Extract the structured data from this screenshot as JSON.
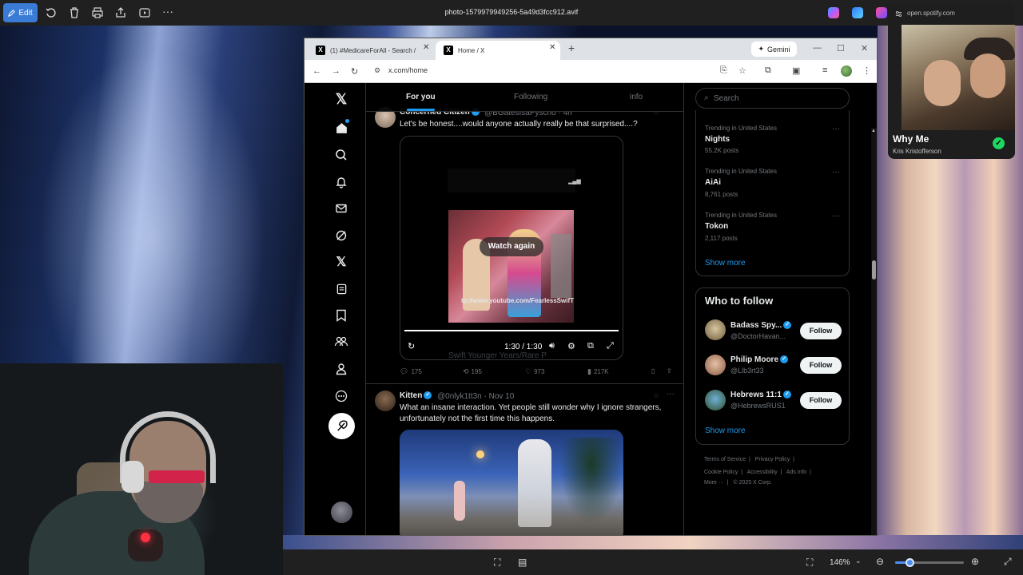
{
  "viewer": {
    "edit_label": "Edit",
    "filename": "photo-1579979949256-5a49d3fcc912.avif",
    "zoom": "146%"
  },
  "spotify": {
    "url": "open.spotify.com",
    "track": "Why Me",
    "artist": "Kris Kristofferson"
  },
  "browser": {
    "tabs": [
      {
        "label": "(1) #MedicareForAll - Search / X"
      },
      {
        "label": "Home / X"
      }
    ],
    "gemini_label": "Gemini",
    "url": "x.com/home"
  },
  "x": {
    "feed_tabs": [
      "For you",
      "Following",
      "info"
    ],
    "tweets": [
      {
        "name": "Concerned Citizen",
        "handle": "@BGatesIsaPyscho · 4h",
        "text": "Let's be honest....would anyone actually really be that surprised....?",
        "video_overlay": "Watch again",
        "video_url": "tp://www.youtube.com/FearlessSwifT",
        "video_time": "1:30 / 1:30",
        "video_under": "Swift Younger Years/Rare P",
        "replies": "175",
        "reposts": "195",
        "likes": "973",
        "views": "217K"
      },
      {
        "name": "Kitten",
        "handle": "@0nlyk1tt3n · Nov 10",
        "text": "What an insane interaction. Yet people still wonder why I ignore strangers, unfortunately not the first time this happens."
      }
    ],
    "search_placeholder": "Search",
    "trends": [
      {
        "meta": "Trending in United States",
        "name": "Nights",
        "count": "55.2K posts"
      },
      {
        "meta": "Trending in United States",
        "name": "AiAi",
        "count": "8,761 posts"
      },
      {
        "meta": "Trending in United States",
        "name": "Tokon",
        "count": "2,117 posts"
      }
    ],
    "show_more": "Show more",
    "who_to_follow": {
      "title": "Who to follow",
      "users": [
        {
          "name": "Badass Spy...",
          "handle": "@DoctorHavan..."
        },
        {
          "name": "Philip Moore",
          "handle": "@Llb3rt33"
        },
        {
          "name": "Hebrews 11:1",
          "handle": "@HebrewsRUS1"
        }
      ],
      "follow_label": "Follow",
      "show_more": "Show more"
    },
    "footer": {
      "line1": [
        "Terms of Service",
        "Privacy Policy"
      ],
      "line2": [
        "Cookie Policy",
        "Accessibility",
        "Ads info"
      ],
      "line3": [
        "More ···",
        "© 2025 X Corp."
      ]
    }
  },
  "colors": {
    "accent": "#1d9bf0",
    "edit_button": "#3a7bd5",
    "spotify_green": "#1ed760"
  }
}
